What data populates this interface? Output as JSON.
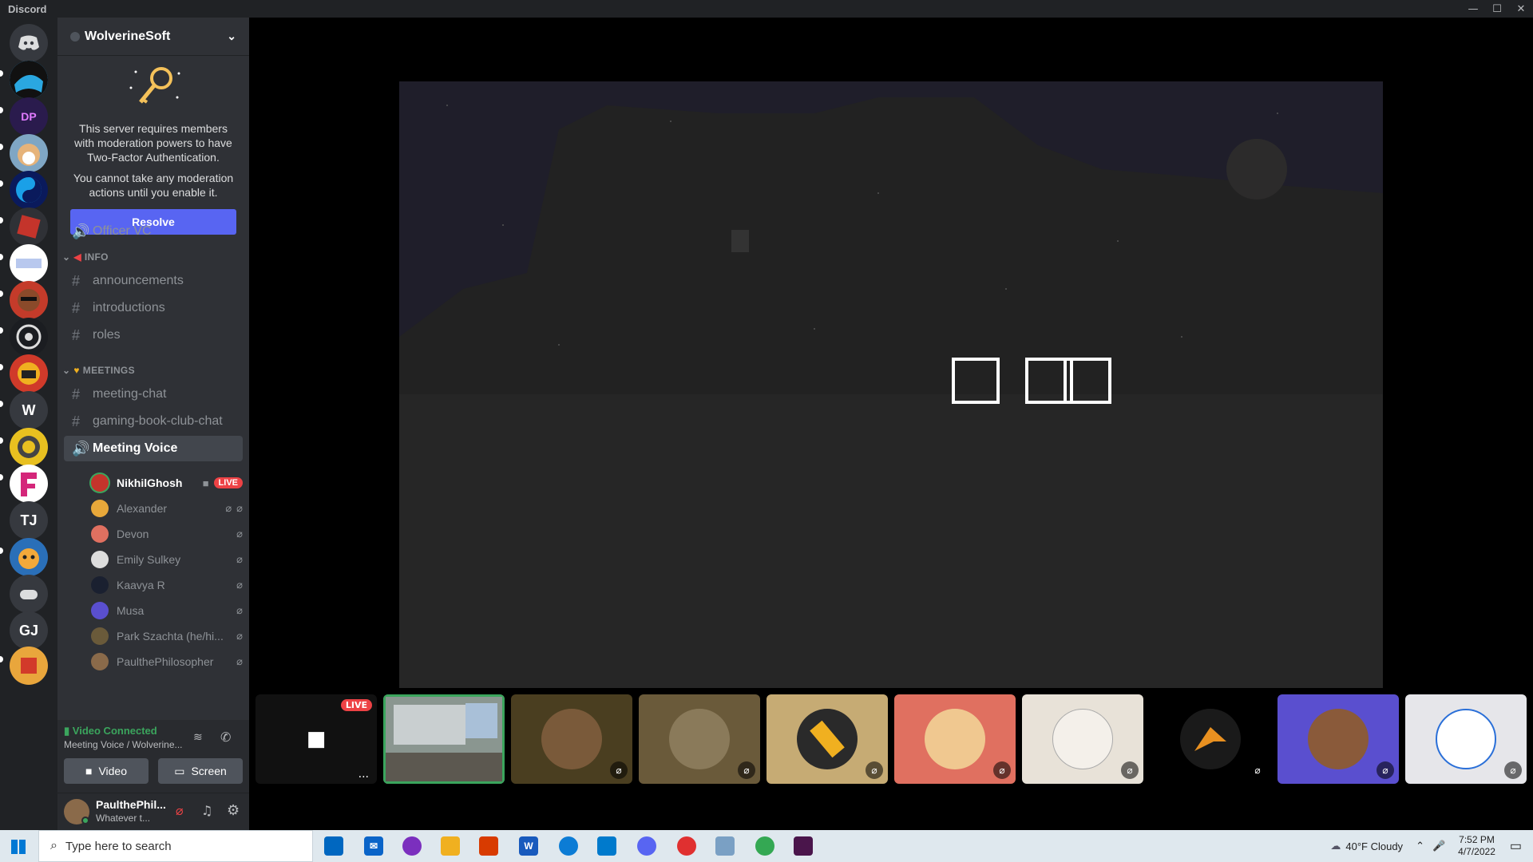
{
  "window": {
    "title": "Discord",
    "minimize": "—",
    "maximize": "☐",
    "close": "✕"
  },
  "rail": {
    "home_icon": "discord-logo-icon",
    "letters": {
      "w": "W",
      "tj": "TJ",
      "gj": "GJ"
    }
  },
  "server": {
    "name": "WolverineSoft"
  },
  "notice": {
    "line1": "This server requires members with moderation powers to have Two-Factor Authentication.",
    "line2": "You cannot take any moderation actions until you enable it.",
    "resolve_label": "Resolve"
  },
  "channels": {
    "officer_vc": "Officer VC",
    "cat_info": "INFO",
    "announcements": "announcements",
    "introductions": "introductions",
    "roles": "roles",
    "cat_meetings": "MEETINGS",
    "meeting_chat": "meeting-chat",
    "gaming_book_club_chat": "gaming-book-club-chat",
    "meeting_voice": "Meeting Voice"
  },
  "voice_users": [
    {
      "name": "NikhilGhosh",
      "live": "LIVE"
    },
    {
      "name": "Alexander"
    },
    {
      "name": "Devon"
    },
    {
      "name": "Emily Sulkey"
    },
    {
      "name": "Kaavya R"
    },
    {
      "name": "Musa"
    },
    {
      "name": "Park Szachta (he/hi..."
    },
    {
      "name": "PaulthePhilosopher"
    }
  ],
  "voice_panel": {
    "status": "Video Connected",
    "sub": "Meeting Voice / Wolverine...",
    "video_label": "Video",
    "screen_label": "Screen"
  },
  "user_panel": {
    "name": "PaulthePhil...",
    "status": "Whatever t..."
  },
  "tiles": {
    "live_badge": "LIVE",
    "more": "..."
  },
  "taskbar": {
    "search_placeholder": "Type here to search",
    "weather": "40°F  Cloudy",
    "time": "7:52 PM",
    "date": "4/7/2022"
  }
}
